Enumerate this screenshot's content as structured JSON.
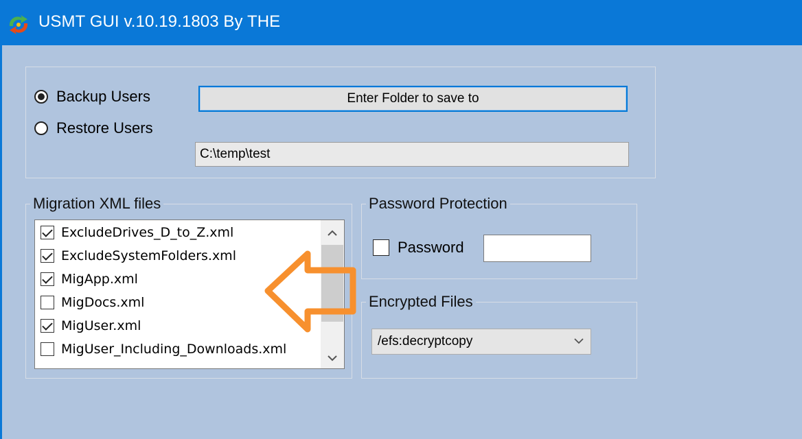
{
  "window": {
    "title": "USMT GUI v.10.19.1803 By THE",
    "app_icon": "refresh-arrows-icon"
  },
  "mode": {
    "backup_label": "Backup Users",
    "restore_label": "Restore Users",
    "selected": "backup"
  },
  "folder": {
    "button_label": "Enter Folder to save to",
    "path_value": "C:\\temp\\test"
  },
  "migration": {
    "legend": "Migration XML files",
    "files": [
      {
        "name": "ExcludeDrives_D_to_Z.xml",
        "checked": true
      },
      {
        "name": "ExcludeSystemFolders.xml",
        "checked": true
      },
      {
        "name": "MigApp.xml",
        "checked": true
      },
      {
        "name": "MigDocs.xml",
        "checked": false
      },
      {
        "name": "MigUser.xml",
        "checked": true
      },
      {
        "name": "MigUser_Including_Downloads.xml",
        "checked": false
      }
    ]
  },
  "password": {
    "legend": "Password Protection",
    "checkbox_label": "Password",
    "checked": false,
    "value": ""
  },
  "encrypted": {
    "legend": "Encrypted Files",
    "selected": "/efs:decryptcopy"
  },
  "colors": {
    "titlebar": "#0a78d7",
    "window_bg": "#b0c4de",
    "arrow": "#f7902e"
  }
}
